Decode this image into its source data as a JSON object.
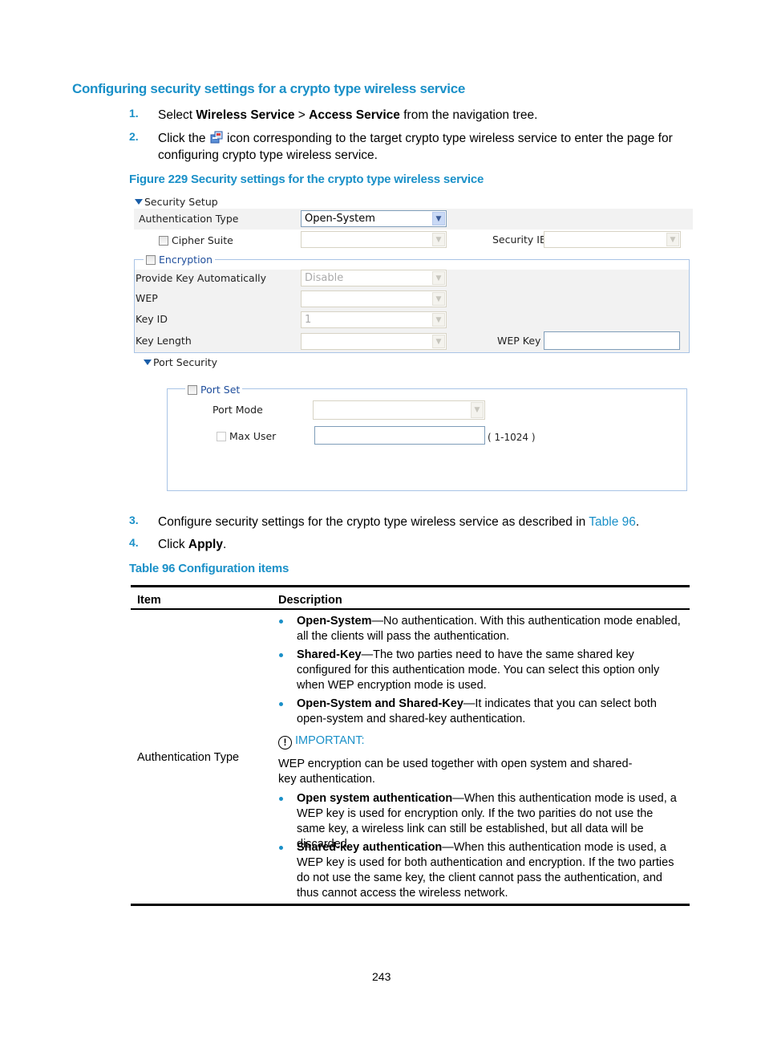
{
  "heading": "Configuring security settings for a crypto type wireless service",
  "steps": [
    {
      "num": "1.",
      "parts": [
        "Select ",
        "Wireless Service",
        " > ",
        "Access Service",
        " from the navigation tree."
      ]
    },
    {
      "num": "2.",
      "line1_pre": "Click the ",
      "icon": "service-config-icon",
      "line1_post": " icon corresponding to the target crypto type wireless service to enter the page for",
      "line2": "configuring crypto type wireless service."
    },
    {
      "num": "3.",
      "pre": "Configure security settings for the crypto type wireless service as described in ",
      "link": "Table 96",
      "post": "."
    },
    {
      "num": "4.",
      "pre": "Click ",
      "bold": "Apply",
      "post": "."
    }
  ],
  "figure_caption": "Figure 229 Security settings for the crypto type wireless service",
  "ui": {
    "security_setup": {
      "title": "Security Setup",
      "authentication_type": {
        "label": "Authentication Type",
        "value": "Open-System"
      },
      "cipher_suite": {
        "label": "Cipher Suite",
        "value": "",
        "checked": false
      },
      "security_ie": {
        "label": "Security IE",
        "value": ""
      },
      "encryption": {
        "legend": "Encryption",
        "checked": false,
        "provide_key": {
          "label": "Provide Key Automatically",
          "value": "Disable"
        },
        "wep": {
          "label": "WEP",
          "value": ""
        },
        "key_id": {
          "label": "Key ID",
          "value": "1"
        },
        "key_length": {
          "label": "Key Length",
          "value": ""
        },
        "wep_key": {
          "label": "WEP Key",
          "value": ""
        }
      }
    },
    "port_security": {
      "title": "Port Security",
      "port_set": {
        "legend": "Port Set",
        "checked": false
      },
      "port_mode": {
        "label": "Port Mode",
        "value": ""
      },
      "max_user": {
        "label": "Max User",
        "value": "",
        "range": "( 1-1024 )",
        "checked": false
      }
    }
  },
  "table_caption": "Table 96 Configuration items",
  "table": {
    "headers": [
      "Item",
      "Description"
    ],
    "rows": [
      {
        "item": "Authentication Type",
        "bullets_a": [
          {
            "term": "Open-System",
            "text": "—No authentication. With this authentication mode enabled, all the clients will pass the authentication."
          },
          {
            "term": "Shared-Key",
            "text": "—The two parties need to have the same shared key configured for this authentication mode. You can select this option only when WEP encryption mode is used."
          },
          {
            "term": "Open-System and Shared-Key",
            "text": "—It indicates that you can select both open-system and shared-key authentication."
          }
        ],
        "important_label": "IMPORTANT:",
        "important_text": "WEP encryption can be used together with open system and shared-key authentication.",
        "bullets_b": [
          {
            "term": "Open system authentication",
            "text": "—When this authentication mode is used, a WEP key is used for encryption only. If the two parities do not use the same key, a wireless link can still be established, but all data will be discarded."
          },
          {
            "term": "Shared-key authentication",
            "text": "—When this authentication mode is used, a WEP key is used for both authentication and encryption. If the two parties do not use the same key, the client cannot pass the authentication, and thus cannot access the wireless network."
          }
        ]
      }
    ]
  },
  "page_number": "243"
}
